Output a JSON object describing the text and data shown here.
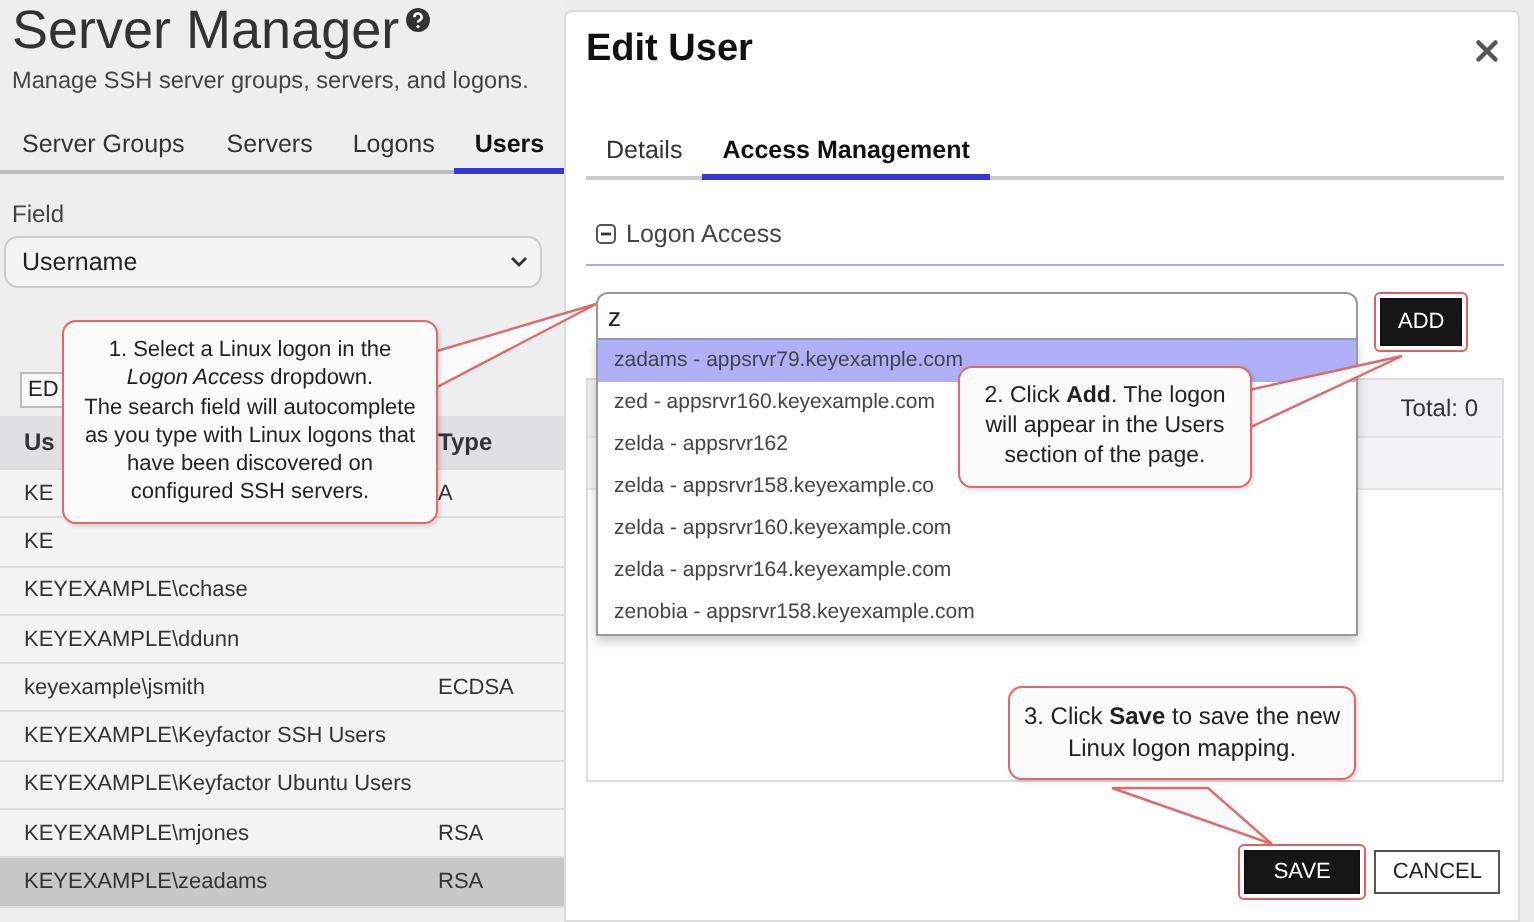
{
  "app": {
    "title": "Server Manager",
    "subtitle": "Manage SSH server groups, servers, and logons.",
    "tabs": [
      {
        "label": "Server Groups",
        "selected": false
      },
      {
        "label": "Servers",
        "selected": false
      },
      {
        "label": "Logons",
        "selected": false
      },
      {
        "label": "Users",
        "selected": true
      }
    ]
  },
  "filter": {
    "label": "Field",
    "value": "Username"
  },
  "table": {
    "toolbar_button": "ED",
    "columns": [
      "Us",
      "Type"
    ],
    "rows": [
      {
        "cells": [
          "KE",
          "A"
        ],
        "selected": false
      },
      {
        "cells": [
          "KE",
          ""
        ],
        "selected": false
      },
      {
        "cells": [
          "KEYEXAMPLE\\cchase",
          ""
        ],
        "selected": false
      },
      {
        "cells": [
          "KEYEXAMPLE\\ddunn",
          ""
        ],
        "selected": false
      },
      {
        "cells": [
          "keyexample\\jsmith",
          "ECDSA"
        ],
        "selected": false
      },
      {
        "cells": [
          "KEYEXAMPLE\\Keyfactor SSH Users",
          ""
        ],
        "selected": false
      },
      {
        "cells": [
          "KEYEXAMPLE\\Keyfactor Ubuntu Users",
          ""
        ],
        "selected": false
      },
      {
        "cells": [
          "KEYEXAMPLE\\mjones",
          "RSA"
        ],
        "selected": false
      },
      {
        "cells": [
          "KEYEXAMPLE\\zeadams",
          "RSA"
        ],
        "selected": true
      }
    ]
  },
  "dialog": {
    "title": "Edit User",
    "tabs": [
      {
        "label": "Details",
        "selected": false
      },
      {
        "label": "Access Management",
        "selected": true
      }
    ],
    "section": {
      "title": "Logon Access",
      "expanded": true
    },
    "search": {
      "value": "z"
    },
    "add_button": "ADD",
    "suggestions": [
      {
        "label": "zadams - appsrvr79.keyexample.com",
        "selected": true
      },
      {
        "label": "zed - appsrvr160.keyexample.com",
        "selected": false
      },
      {
        "label": "zelda - appsrvr162",
        "selected": false
      },
      {
        "label": "zelda - appsrvr158.keyexample.co",
        "selected": false
      },
      {
        "label": "zelda - appsrvr160.keyexample.com",
        "selected": false
      },
      {
        "label": "zelda - appsrvr164.keyexample.com",
        "selected": false
      },
      {
        "label": "zenobia - appsrvr158.keyexample.com",
        "selected": false
      }
    ],
    "users_panel": {
      "total": "Total: 0"
    },
    "buttons": [
      {
        "label": "SAVE",
        "kind": "primary"
      },
      {
        "label": "CANCEL",
        "kind": "secondary"
      }
    ]
  },
  "callouts": [
    {
      "paragraphs": [
        "1. Select a Linux logon in the *Logon Access* dropdown.",
        "The search field will autocomplete as you type with Linux logons that have been discovered on configured SSH servers."
      ]
    },
    {
      "paragraphs": [
        "2. Click **Add**. The logon will appear in the Users section of the page."
      ]
    },
    {
      "paragraphs": [
        "3. Click **Save** to save the new Linux logon mapping."
      ]
    }
  ]
}
